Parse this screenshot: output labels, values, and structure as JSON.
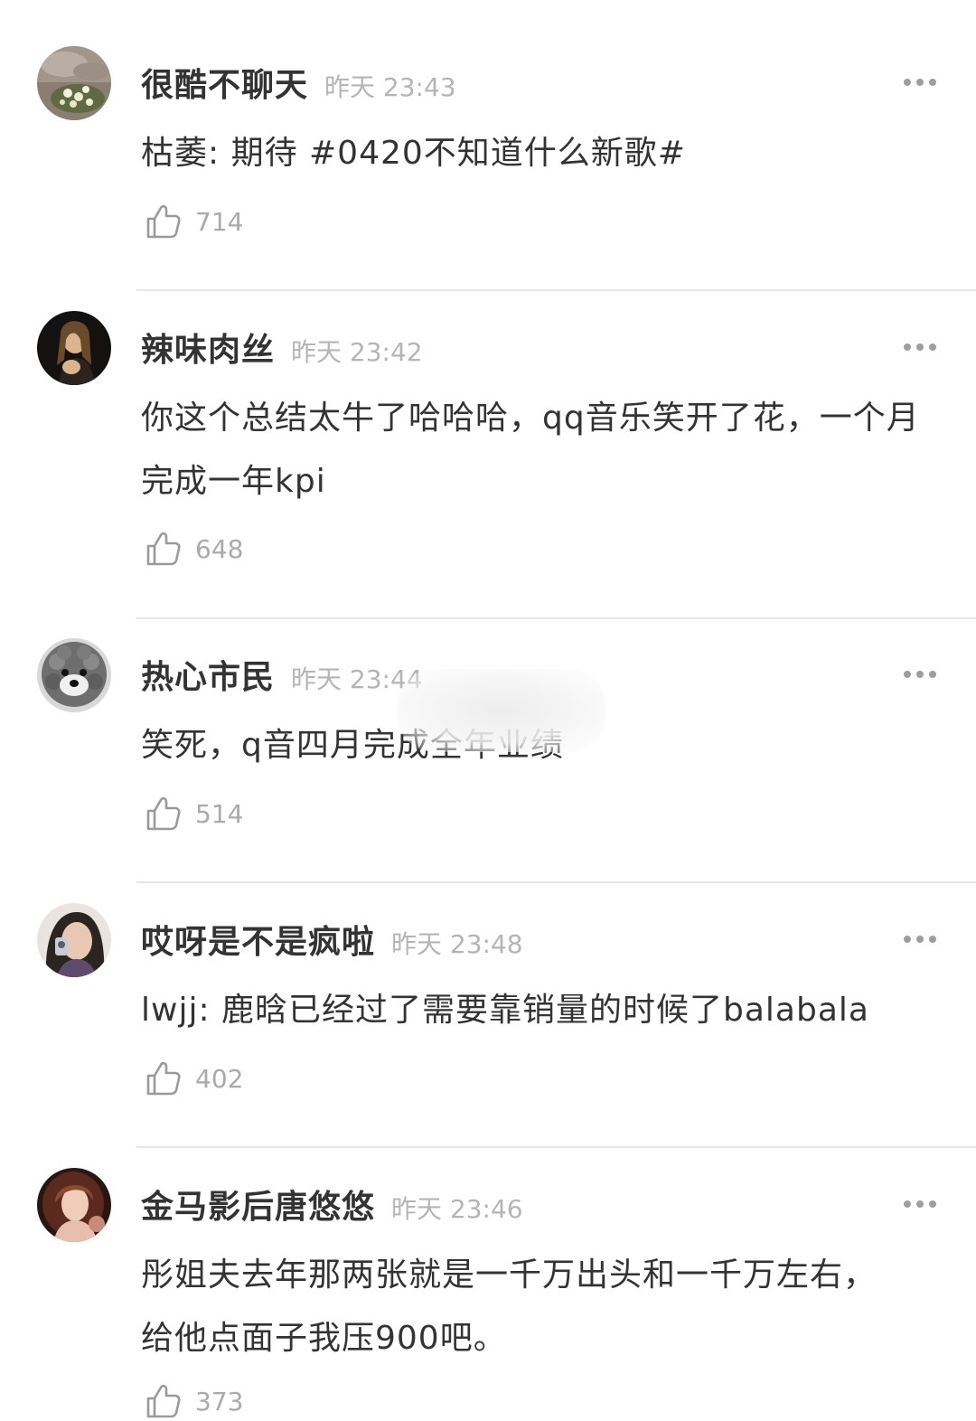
{
  "comments": [
    {
      "username": "很酷不聊天",
      "time": "昨天 23:43",
      "content": "枯萎: 期待 #0420不知道什么新歌#",
      "likes": "714",
      "avatar_icon": "flower-photo-avatar"
    },
    {
      "username": "辣味肉丝",
      "time": "昨天 23:42",
      "content": "你这个总结太牛了哈哈哈，qq音乐笑开了花，一个月完成一年kpi",
      "likes": "648",
      "avatar_icon": "portrait-photo-avatar"
    },
    {
      "username": "热心市民",
      "time": "昨天 23:44",
      "content": "笑死，q音四月完成全年业绩",
      "likes": "514",
      "avatar_icon": "dog-photo-avatar"
    },
    {
      "username": "哎呀是不是疯啦",
      "time": "昨天 23:48",
      "content": "lwjj: 鹿晗已经过了需要靠销量的时候了balabala",
      "likes": "402",
      "avatar_icon": "selfie-photo-avatar"
    },
    {
      "username": "金马影后唐悠悠",
      "time": "昨天 23:46",
      "content": "彤姐夫去年那两张就是一千万出头和一千万左右，给他点面子我压900吧。",
      "likes": "373",
      "avatar_icon": "portrait-photo-avatar"
    }
  ],
  "colors": {
    "username": "#333333",
    "timestamp": "#b5b5b5",
    "like_count": "#aaaaaa",
    "divider": "#e6e6e6"
  }
}
